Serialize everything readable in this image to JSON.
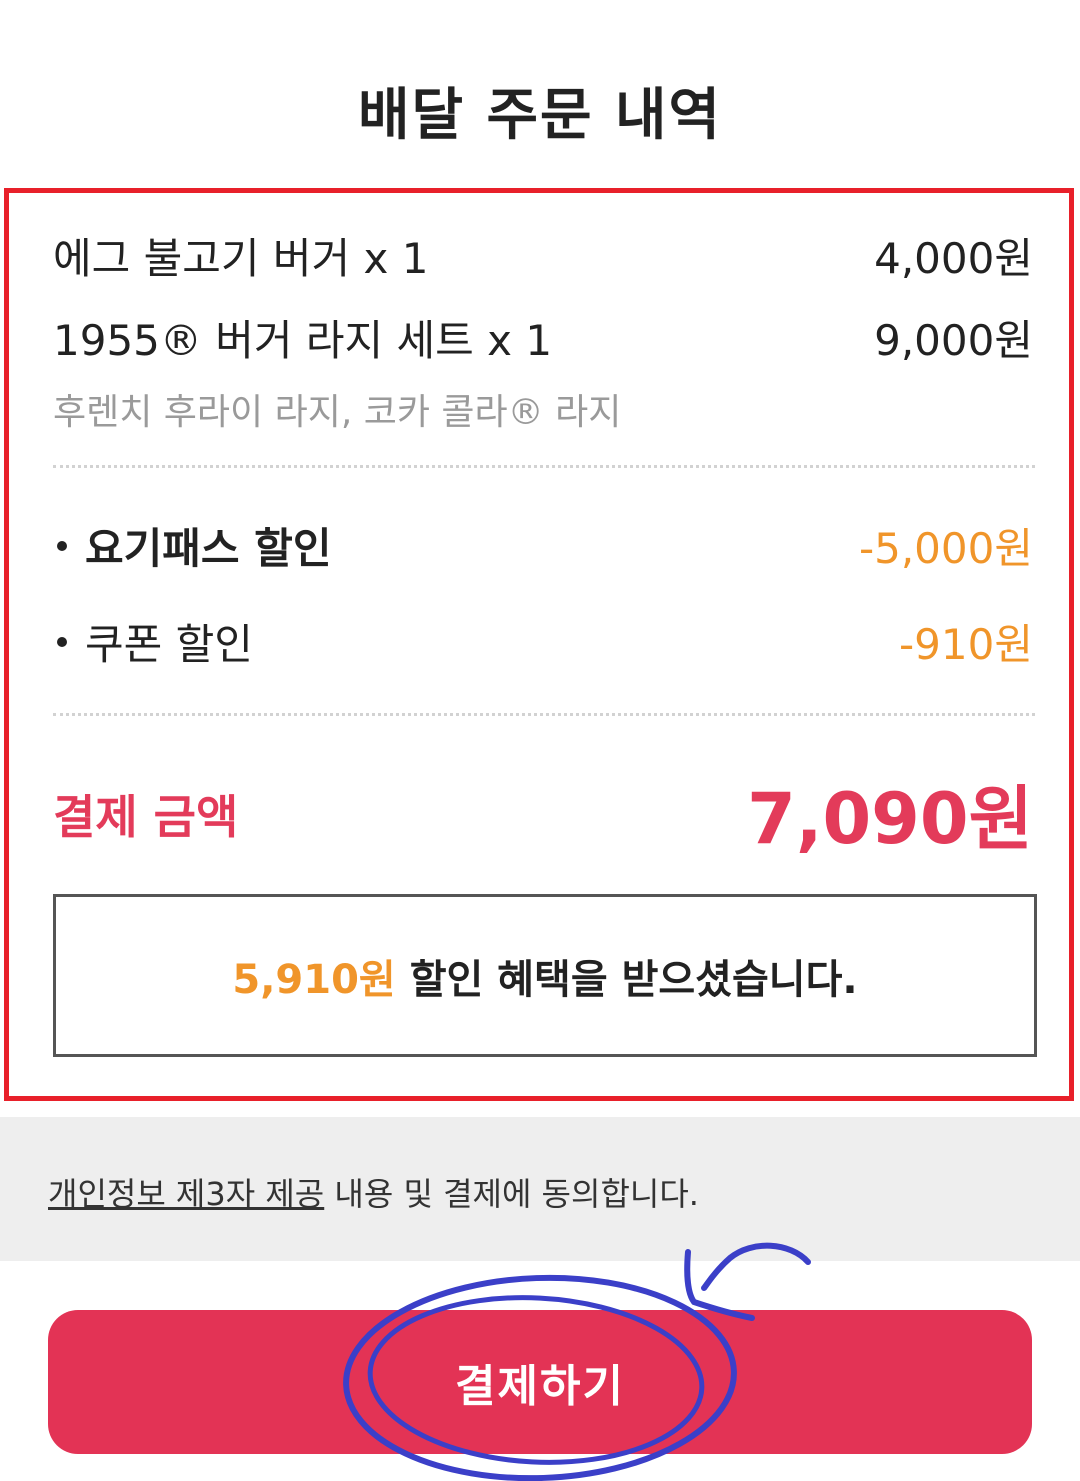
{
  "page": {
    "title": "배달 주문 내역"
  },
  "order": {
    "items": [
      {
        "name": "에그 불고기 버거 x 1",
        "price": "4,000원"
      },
      {
        "name": "1955® 버거 라지 세트 x 1",
        "price": "9,000원",
        "options": "후렌치 후라이 라지, 코카 콜라® 라지"
      }
    ]
  },
  "discounts": [
    {
      "label": "요기패스 할인",
      "value": "-5,000원"
    },
    {
      "label": "쿠폰 할인",
      "value": "-910원"
    }
  ],
  "total": {
    "label": "결제 금액",
    "value": "7,090원"
  },
  "benefit": {
    "amount": "5,910원",
    "message": "할인 혜택을 받으셨습니다."
  },
  "consent": {
    "link_text": "개인정보 제3자 제공",
    "rest_text": " 내용 및 결제에 동의합니다."
  },
  "pay_button": {
    "label": "결제하기"
  },
  "colors": {
    "highlight_border": "#e8202a",
    "accent_pink": "#e33355",
    "discount_orange": "#f0952a",
    "annotation_blue": "#3b3fc8"
  }
}
